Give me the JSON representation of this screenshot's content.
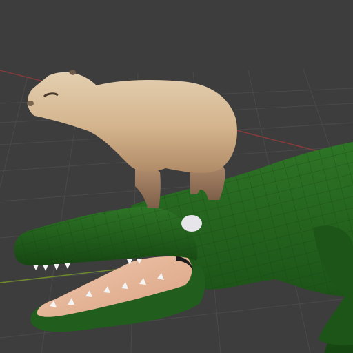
{
  "viewport": {
    "background_color": "#3d3d3d",
    "grid_color": "#4a4a4a",
    "axis_x_color": "#8a3a3a",
    "axis_y_color": "#6f8a2c"
  },
  "scene": {
    "objects": [
      {
        "name": "capybara",
        "fur_color": "#c9a882",
        "leg_color": "#9b7a5e"
      },
      {
        "name": "crocodile",
        "skin_color": "#245f1e",
        "mouth_color": "#e8b89a",
        "eye_color": "#e6e6ea",
        "teeth_color": "#f4f4f4"
      }
    ]
  }
}
